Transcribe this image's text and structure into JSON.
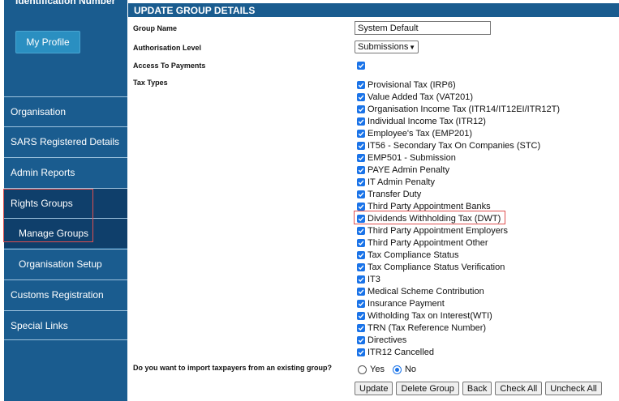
{
  "sidebar": {
    "header_text": "Identification Number",
    "profile_button": "My Profile",
    "items": [
      {
        "label": "Organisation"
      },
      {
        "label": "SARS Registered Details"
      },
      {
        "label": "Admin Reports"
      },
      {
        "label": "Rights Groups"
      },
      {
        "label": "Manage Groups"
      },
      {
        "label": "Organisation Setup"
      },
      {
        "label": "Customs Registration"
      },
      {
        "label": "Special Links"
      }
    ]
  },
  "form": {
    "title": "UPDATE GROUP DETAILS",
    "group_name_label": "Group Name",
    "group_name_value": "System Default",
    "auth_level_label": "Authorisation Level",
    "auth_level_value": "Submissions",
    "access_payments_label": "Access To Payments",
    "tax_types_label": "Tax Types",
    "tax_types": [
      "Provisional Tax (IRP6)",
      "Value Added Tax (VAT201)",
      "Organisation Income Tax (ITR14/IT12EI/ITR12T)",
      "Individual Income Tax (ITR12)",
      "Employee's Tax (EMP201)",
      "IT56 - Secondary Tax On Companies (STC)",
      "EMP501 - Submission",
      "PAYE Admin Penalty",
      "IT Admin Penalty",
      "Transfer Duty",
      "Third Party Appointment Banks",
      "Dividends Withholding Tax (DWT)",
      "Third Party Appointment Employers",
      "Third Party Appointment Other",
      "Tax Compliance Status",
      "Tax Compliance Status Verification",
      "IT3",
      "Medical Scheme Contribution",
      "Insurance Payment",
      "Witholding Tax on Interest(WTI)",
      "TRN (Tax Reference Number)",
      "Directives",
      "ITR12 Cancelled"
    ],
    "import_question": "Do you want to import taxpayers from an existing group?",
    "radio_yes": "Yes",
    "radio_no": "No",
    "buttons": {
      "update": "Update",
      "delete_group": "Delete Group",
      "back": "Back",
      "check_all": "Check All",
      "uncheck_all": "Uncheck All"
    }
  },
  "colors": {
    "sidebar_blue": "#1a5c8f",
    "sidebar_dark": "#0f3f6b",
    "checkbox_blue": "#1a73e8",
    "highlight_red": "#e05050"
  }
}
